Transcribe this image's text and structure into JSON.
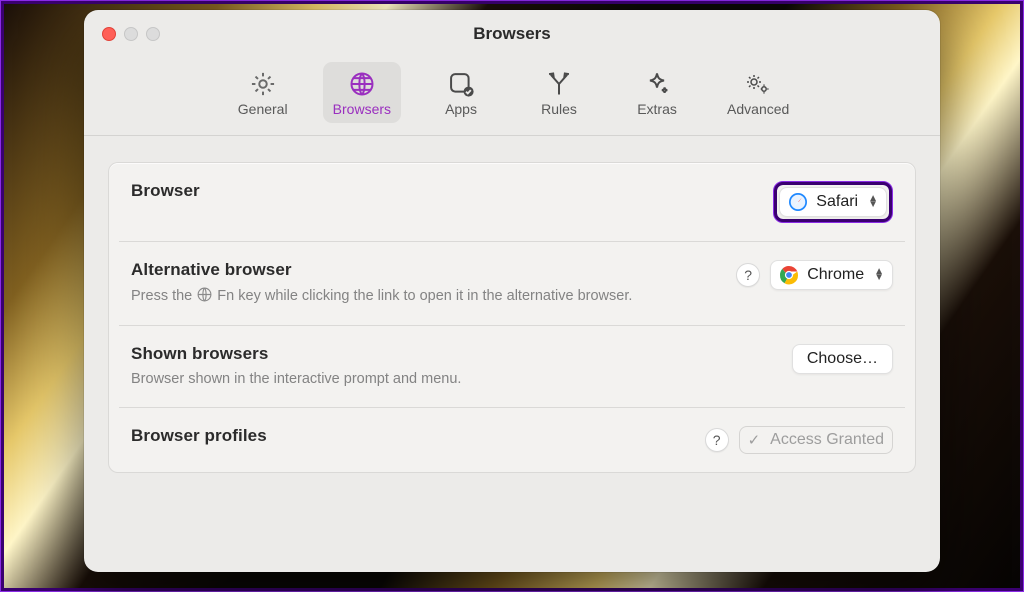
{
  "window": {
    "title": "Browsers"
  },
  "tabs": {
    "general": {
      "label": "General"
    },
    "browsers": {
      "label": "Browsers"
    },
    "apps": {
      "label": "Apps"
    },
    "rules": {
      "label": "Rules"
    },
    "extras": {
      "label": "Extras"
    },
    "advanced": {
      "label": "Advanced"
    },
    "active": "browsers"
  },
  "rows": {
    "default": {
      "label": "Browser",
      "value": "Safari",
      "icon": "safari-icon"
    },
    "alt": {
      "label": "Alternative browser",
      "hint_prefix": "Press the ",
      "hint_suffix": " Fn key while clicking the link to open it in the alternative browser.",
      "value": "Chrome",
      "icon": "chrome-icon"
    },
    "shown": {
      "label": "Shown browsers",
      "hint": "Browser shown in the interactive prompt and menu.",
      "button": "Choose…"
    },
    "profiles": {
      "label": "Browser profiles",
      "status": "Access Granted"
    }
  },
  "help_glyph": "?"
}
